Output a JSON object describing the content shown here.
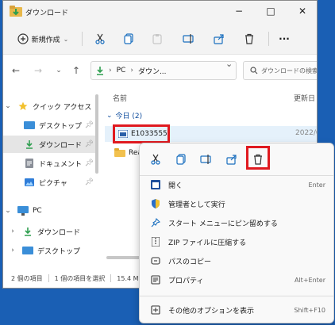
{
  "window": {
    "title": "ダウンロード",
    "controls": {
      "minimize": "−",
      "maximize": "□",
      "close": "✕"
    }
  },
  "toolbar": {
    "new_label": "新規作成",
    "more_label": "···"
  },
  "nav": {
    "breadcrumb": [
      "PC",
      "ダウン..."
    ],
    "search_placeholder": "ダウンロードの検索"
  },
  "sidebar": {
    "quick_access_label": "クイック アクセス",
    "quick_items": [
      "デスクトップ",
      "ダウンロード",
      "ドキュメント",
      "ピクチャ"
    ],
    "pc_label": "PC",
    "pc_items": [
      "ダウンロード",
      "デスクトップ"
    ],
    "selected": "ダウンロード"
  },
  "content": {
    "column_name": "名前",
    "column_modified": "更新日",
    "group_label": "今日 (2)",
    "file_name": "E1033555",
    "file_date": "2022/0",
    "folder_name": "Rea"
  },
  "status": {
    "item_count": "2 個の項目",
    "selected": "1 個の項目を選択",
    "size": "15.4 M"
  },
  "context_menu": {
    "items": [
      {
        "label": "開く",
        "shortcut": "Enter",
        "icon": "open-icon"
      },
      {
        "label": "管理者として実行",
        "shortcut": "",
        "icon": "shield-icon"
      },
      {
        "label": "スタート メニューにピン留めする",
        "shortcut": "",
        "icon": "pin-icon"
      },
      {
        "label": "ZIP ファイルに圧縮する",
        "shortcut": "",
        "icon": "zip-icon"
      },
      {
        "label": "パスのコピー",
        "shortcut": "",
        "icon": "path-copy-icon"
      },
      {
        "label": "プロパティ",
        "shortcut": "Alt+Enter",
        "icon": "properties-icon"
      }
    ],
    "more_options": {
      "label": "その他のオプションを表示",
      "shortcut": "Shift+F10"
    },
    "highlight_color": "#e0191f"
  },
  "colors": {
    "desktop": "#1a5fb4",
    "accent_green": "#2e9e4f",
    "selection_bg": "#e5f1fb",
    "highlight_red": "#e0191f"
  }
}
